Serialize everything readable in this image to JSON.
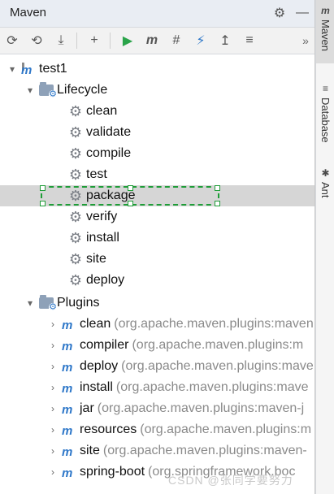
{
  "panel": {
    "title": "Maven",
    "title_actions": [
      "gear-icon",
      "minimize-icon"
    ],
    "toolbar": {
      "buttons": [
        {
          "icon": "reload-icon",
          "label": "Reload All Maven Projects"
        },
        {
          "icon": "reimport-icon",
          "label": "Generate Sources"
        },
        {
          "icon": "download-icon",
          "label": "Download Sources"
        },
        {
          "icon": "add-icon",
          "label": "Add Maven Project"
        },
        {
          "icon": "run-icon",
          "label": "Run Maven Build"
        },
        {
          "icon": "maven-icon",
          "label": "Execute Maven Goal"
        },
        {
          "icon": "toggle-offline-icon",
          "label": "Toggle Offline Mode"
        },
        {
          "icon": "lightning-icon",
          "label": "Skip Tests Mode"
        },
        {
          "icon": "show-deps-icon",
          "label": "Show Dependencies"
        },
        {
          "icon": "collapse-icon",
          "label": "Collapse All"
        },
        {
          "icon": "more-icon",
          "label": "More"
        }
      ],
      "glyphs": [
        "⟳",
        "⟲",
        "⤓",
        "+",
        "▶",
        "m",
        "#",
        "⚡",
        "↥",
        "≡",
        "»"
      ]
    }
  },
  "tree": {
    "root": {
      "label": "test1"
    },
    "lifecycle": {
      "label": "Lifecycle",
      "items": [
        "clean",
        "validate",
        "compile",
        "test",
        "package",
        "verify",
        "install",
        "site",
        "deploy"
      ]
    },
    "plugins": {
      "label": "Plugins",
      "items": [
        {
          "name": "clean",
          "meta": "(org.apache.maven.plugins:maven"
        },
        {
          "name": "compiler",
          "meta": "(org.apache.maven.plugins:m"
        },
        {
          "name": "deploy",
          "meta": "(org.apache.maven.plugins:mave"
        },
        {
          "name": "install",
          "meta": "(org.apache.maven.plugins:mave"
        },
        {
          "name": "jar",
          "meta": "(org.apache.maven.plugins:maven-j"
        },
        {
          "name": "resources",
          "meta": "(org.apache.maven.plugins:m"
        },
        {
          "name": "site",
          "meta": "(org.apache.maven.plugins:maven-"
        },
        {
          "name": "spring-boot",
          "meta": "(org.springframework.boc"
        }
      ]
    },
    "selected": "package"
  },
  "sidebar": {
    "tabs": [
      {
        "label": "Maven",
        "icon": "maven-icon",
        "active": true
      },
      {
        "label": "Database",
        "icon": "database-icon",
        "active": false
      },
      {
        "label": "Ant",
        "icon": "ant-icon",
        "active": false
      }
    ]
  },
  "watermark": "CSDN @张同学要努力",
  "colors": {
    "accent": "#2f78c9",
    "selection_outline": "#1f9d38",
    "selected_row": "#d6d6d6"
  }
}
